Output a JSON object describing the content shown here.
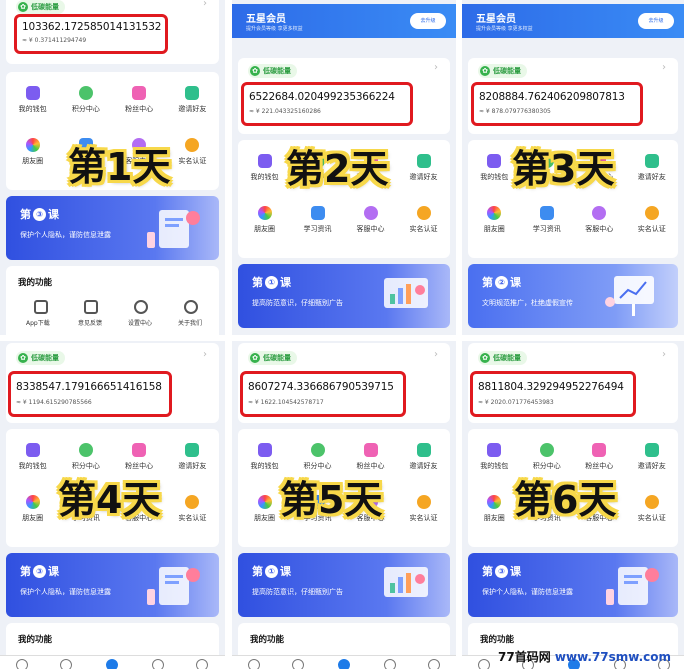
{
  "eco_label": "低碳能量",
  "chevron": "›",
  "vip": {
    "title": "五星会员",
    "subtitle": "提升会员等级 享更多权益",
    "button": "去升级"
  },
  "menu_row1": [
    "我的钱包",
    "积分中心",
    "粉丝中心",
    "邀请好友"
  ],
  "menu_row2": [
    "朋友圈",
    "学习资讯",
    "客服中心",
    "实名认证"
  ],
  "lesson_prefix": "第",
  "lesson_suffix": "课",
  "lesson_privacy": "保护个人隐私，谨防信息泄露",
  "lesson_fraud": "提高防范意识，仔细甄别广告",
  "lesson_civil": "文明规范推广，杜绝虚假宣传",
  "my_functions": "我的功能",
  "functions": [
    "App下载",
    "意见反馈",
    "设置中心",
    "关于我们"
  ],
  "panels": [
    {
      "day": "第1天",
      "big": "103362.172585014131532",
      "small": "≈ ¥ 0.371411294749",
      "lesson_num": "③"
    },
    {
      "day": "第2天",
      "big": "6522684.020499235366224",
      "small": "≈ ¥ 221.043325160286",
      "lesson_num": "①"
    },
    {
      "day": "第3天",
      "big": "8208884.762406209807813",
      "small": "≈ ¥ 878.079776380305",
      "lesson_num": "②"
    },
    {
      "day": "第4天",
      "big": "8338547.179166651416158",
      "small": "≈ ¥ 1194.615290785566",
      "lesson_num": "③"
    },
    {
      "day": "第5天",
      "big": "8607274.336686790539715",
      "small": "≈ ¥ 1622.104542578717",
      "lesson_num": "①"
    },
    {
      "day": "第6天",
      "big": "8811804.329294952276494",
      "small": "≈ ¥ 2020.071776453983",
      "lesson_num": "③"
    }
  ],
  "watermark": {
    "prefix": "77首码网",
    "site": "www.77smw.com"
  },
  "colors": {
    "highlight": "#e0191f",
    "brand_blue": "#2d6be8",
    "eco_green": "#37b24d",
    "overlay_text": "#111111",
    "overlay_outline": "#f7d84a"
  }
}
